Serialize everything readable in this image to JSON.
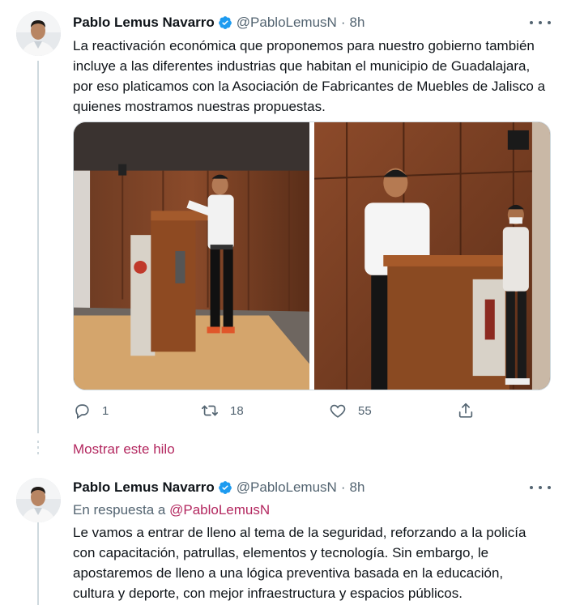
{
  "tweet1": {
    "author_name": "Pablo Lemus Navarro",
    "handle": "@PabloLemusN",
    "separator": "·",
    "time": "8h",
    "text_lines": [
      "La reactivación económica que proponemos para nuestro gobierno también",
      "incluye a las diferentes industrias que habitan el municipio de Guadalajara,",
      "por eso platicamos con la Asociación de Fabricantes de Muebles de Jalisco a",
      "quienes mostramos nuestras propuestas."
    ],
    "actions": {
      "reply_count": "1",
      "retweet_count": "18",
      "like_count": "55"
    }
  },
  "show_thread_label": "Mostrar este hilo",
  "tweet2": {
    "author_name": "Pablo Lemus Navarro",
    "handle": "@PabloLemusN",
    "separator": "·",
    "time": "8h",
    "reply_prefix": "En respuesta a",
    "reply_mention": "@PabloLemusN",
    "text_lines": [
      "Le vamos a entrar de lleno al tema de la seguridad, reforzando a la policía",
      "con capacitación, patrullas, elementos y tecnología. Sin embargo, le",
      "apostaremos de lleno a una lógica preventiva basada en la educación,",
      "cultura y deporte, con mejor infraestructura y espacios públicos."
    ]
  },
  "icons": {
    "verified": "verified-badge-icon",
    "more": "more-dots-icon",
    "reply": "reply-icon",
    "retweet": "retweet-icon",
    "like": "heart-icon",
    "share": "share-icon"
  },
  "colors": {
    "accent": "#b3275f",
    "verified": "#1d9bf0",
    "secondary_text": "#536471",
    "border": "#cfd9de"
  }
}
